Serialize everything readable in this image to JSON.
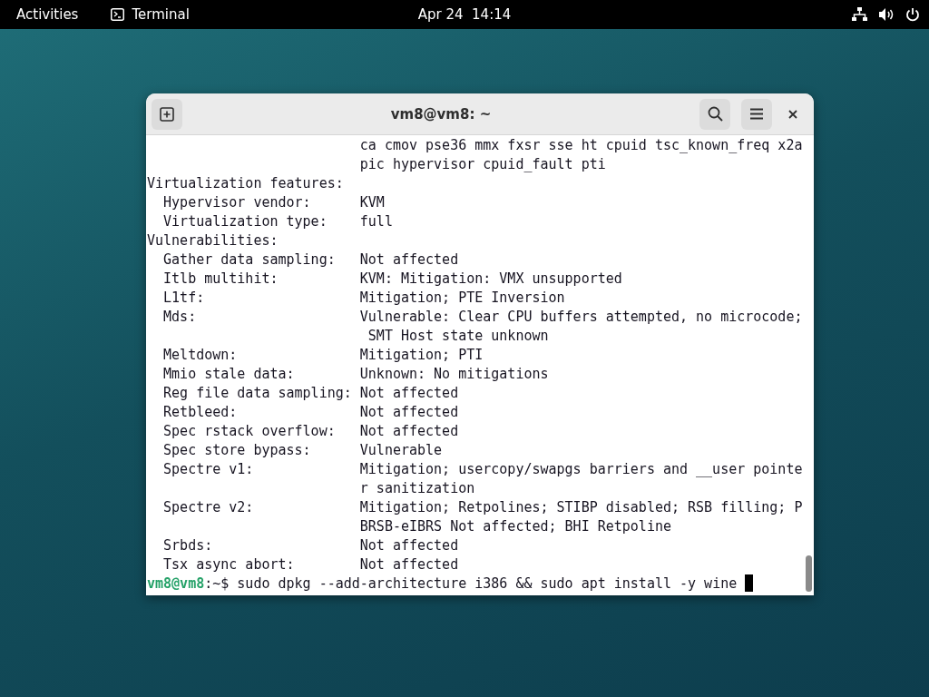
{
  "top_bar": {
    "activities": "Activities",
    "app_name": "Terminal",
    "clock": "Apr 24  14:14"
  },
  "window": {
    "title": "vm8@vm8: ~",
    "lines": [
      "                          ca cmov pse36 mmx fxsr sse ht cpuid tsc_known_freq x2a",
      "                          pic hypervisor cpuid_fault pti",
      "Virtualization features:",
      "  Hypervisor vendor:      KVM",
      "  Virtualization type:    full",
      "Vulnerabilities:",
      "  Gather data sampling:   Not affected",
      "  Itlb multihit:          KVM: Mitigation: VMX unsupported",
      "  L1tf:                   Mitigation; PTE Inversion",
      "  Mds:                    Vulnerable: Clear CPU buffers attempted, no microcode;",
      "                           SMT Host state unknown",
      "  Meltdown:               Mitigation; PTI",
      "  Mmio stale data:        Unknown: No mitigations",
      "  Reg file data sampling: Not affected",
      "  Retbleed:               Not affected",
      "  Spec rstack overflow:   Not affected",
      "  Spec store bypass:      Vulnerable",
      "  Spectre v1:             Mitigation; usercopy/swapgs barriers and __user pointe",
      "                          r sanitization",
      "  Spectre v2:             Mitigation; Retpolines; STIBP disabled; RSB filling; P",
      "                          BRSB-eIBRS Not affected; BHI Retpoline",
      "  Srbds:                  Not affected",
      "  Tsx async abort:        Not affected"
    ],
    "prompt": {
      "user_host": "vm8@vm8",
      "suffix": ":~$ ",
      "command": "sudo dpkg --add-architecture i386 && sudo apt install -y wine "
    }
  }
}
